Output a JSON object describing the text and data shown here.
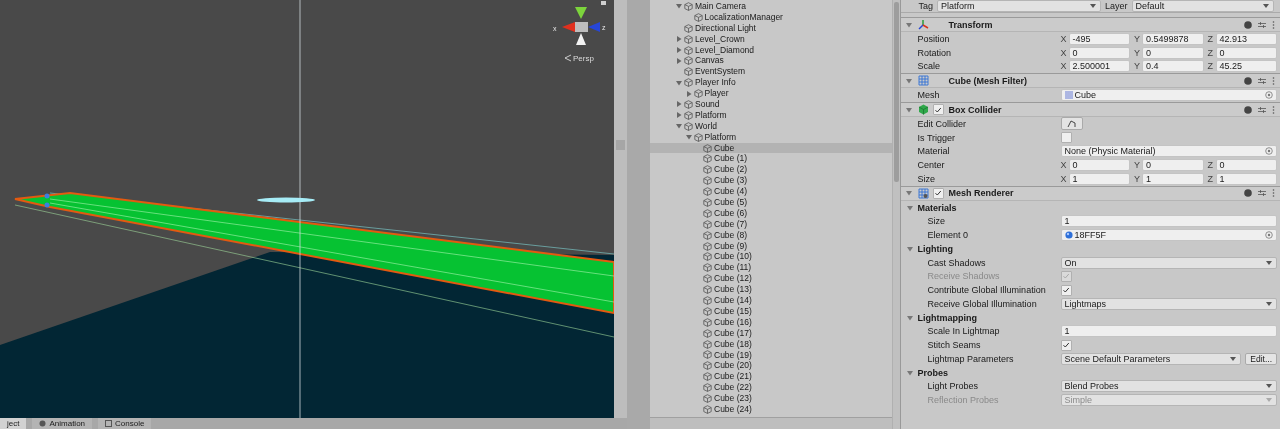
{
  "scene": {
    "gizmo": {
      "x_label": "x",
      "z_label": "z",
      "projection": "Persp"
    }
  },
  "bottom_tabs": [
    {
      "label": "ject",
      "selected": true
    },
    {
      "label": "Animation",
      "selected": false
    },
    {
      "label": "Console",
      "selected": false
    }
  ],
  "hierarchy": {
    "items": [
      {
        "label": "Main Camera",
        "expanded": true,
        "selected": false,
        "children": [
          {
            "label": "LocalizationManager",
            "selected": false
          }
        ]
      },
      {
        "label": "Directional Light",
        "selected": false
      },
      {
        "label": "Level_Crown",
        "expanded": false,
        "selected": false
      },
      {
        "label": "Level_Diamond",
        "expanded": false,
        "selected": false
      },
      {
        "label": "Canvas",
        "expanded": false,
        "selected": false
      },
      {
        "label": "EventSystem",
        "selected": false
      },
      {
        "label": "Player Info",
        "expanded": true,
        "selected": false,
        "children": [
          {
            "label": "Player",
            "expanded": false,
            "selected": false
          }
        ]
      },
      {
        "label": "Sound",
        "expanded": false,
        "selected": false
      },
      {
        "label": "Platform",
        "expanded": false,
        "selected": false
      },
      {
        "label": "World",
        "expanded": true,
        "selected": false,
        "children": [
          {
            "label": "Platform",
            "expanded": true,
            "selected": false,
            "children": [
              {
                "label": "Cube",
                "selected": true
              },
              {
                "label": "Cube (1)",
                "selected": false
              },
              {
                "label": "Cube (2)",
                "selected": false
              },
              {
                "label": "Cube (3)",
                "selected": false
              },
              {
                "label": "Cube (4)",
                "selected": false
              },
              {
                "label": "Cube (5)",
                "selected": false
              },
              {
                "label": "Cube (6)",
                "selected": false
              },
              {
                "label": "Cube (7)",
                "selected": false
              },
              {
                "label": "Cube (8)",
                "selected": false
              },
              {
                "label": "Cube (9)",
                "selected": false
              },
              {
                "label": "Cube (10)",
                "selected": false
              },
              {
                "label": "Cube (11)",
                "selected": false
              },
              {
                "label": "Cube (12)",
                "selected": false
              },
              {
                "label": "Cube (13)",
                "selected": false
              },
              {
                "label": "Cube (14)",
                "selected": false
              },
              {
                "label": "Cube (15)",
                "selected": false
              },
              {
                "label": "Cube (16)",
                "selected": false
              },
              {
                "label": "Cube (17)",
                "selected": false
              },
              {
                "label": "Cube (18)",
                "selected": false
              },
              {
                "label": "Cube (19)",
                "selected": false
              },
              {
                "label": "Cube (20)",
                "selected": false
              },
              {
                "label": "Cube (21)",
                "selected": false
              },
              {
                "label": "Cube (22)",
                "selected": false
              },
              {
                "label": "Cube (23)",
                "selected": false
              },
              {
                "label": "Cube (24)",
                "selected": false
              }
            ]
          }
        ]
      }
    ]
  },
  "inspector": {
    "tag": {
      "label": "Tag",
      "value": "Platform"
    },
    "layer": {
      "label": "Layer",
      "value": "Default"
    },
    "components": [
      {
        "title": "Transform",
        "kind": "transform",
        "expanded": true,
        "rows": [
          {
            "kind": "vector3",
            "label": "Position",
            "disabled": false,
            "values": [
              {
                "axis": "X",
                "value": "-495"
              },
              {
                "axis": "Y",
                "value": "0.5499878"
              },
              {
                "axis": "Z",
                "value": "42.913"
              }
            ]
          },
          {
            "kind": "vector3",
            "label": "Rotation",
            "disabled": false,
            "values": [
              {
                "axis": "X",
                "value": "0"
              },
              {
                "axis": "Y",
                "value": "0"
              },
              {
                "axis": "Z",
                "value": "0"
              }
            ]
          },
          {
            "kind": "vector3",
            "label": "Scale",
            "disabled": false,
            "values": [
              {
                "axis": "X",
                "value": "2.500001"
              },
              {
                "axis": "Y",
                "value": "0.4"
              },
              {
                "axis": "Z",
                "value": "45.25"
              }
            ]
          }
        ]
      },
      {
        "title": "Cube (Mesh Filter)",
        "kind": "meshfilter",
        "expanded": true,
        "rows": [
          {
            "kind": "meshref",
            "label": "Mesh",
            "value": "Cube",
            "disabled": false
          }
        ]
      },
      {
        "title": "Box Collider",
        "kind": "collider",
        "enabled": true,
        "expanded": true,
        "rows": [
          {
            "kind": "button",
            "label": "Edit Collider",
            "disabled": false
          },
          {
            "kind": "checkbox",
            "label": "Is Trigger",
            "checked": false,
            "disabled": false
          },
          {
            "kind": "object",
            "label": "Material",
            "value": "None (Physic Material)",
            "disabled": false
          },
          {
            "kind": "vector3",
            "label": "Center",
            "disabled": false,
            "values": [
              {
                "axis": "X",
                "value": "0"
              },
              {
                "axis": "Y",
                "value": "0"
              },
              {
                "axis": "Z",
                "value": "0"
              }
            ]
          },
          {
            "kind": "vector3",
            "label": "Size",
            "disabled": false,
            "values": [
              {
                "axis": "X",
                "value": "1"
              },
              {
                "axis": "Y",
                "value": "1"
              },
              {
                "axis": "Z",
                "value": "1"
              }
            ]
          }
        ]
      },
      {
        "title": "Mesh Renderer",
        "kind": "renderer",
        "enabled": true,
        "expanded": true,
        "rows": [
          {
            "kind": "section",
            "label": "Materials",
            "expanded": true,
            "disabled": false,
            "rows": [
              {
                "kind": "text",
                "label": "Size",
                "value": "1",
                "disabled": false
              },
              {
                "kind": "materialref",
                "label": "Element 0",
                "value": "18FF5F",
                "disabled": false
              }
            ]
          },
          {
            "kind": "section",
            "label": "Lighting",
            "expanded": true,
            "disabled": false,
            "rows": [
              {
                "kind": "dropdown",
                "label": "Cast Shadows",
                "value": "On",
                "disabled": false
              },
              {
                "kind": "checkbox",
                "label": "Receive Shadows",
                "checked": true,
                "disabled": true
              },
              {
                "kind": "checkbox",
                "label": "Contribute Global Illumination",
                "checked": true,
                "disabled": false
              },
              {
                "kind": "dropdown",
                "label": "Receive Global Illumination",
                "value": "Lightmaps",
                "disabled": false
              }
            ]
          },
          {
            "kind": "section",
            "label": "Lightmapping",
            "expanded": true,
            "disabled": false,
            "rows": [
              {
                "kind": "text",
                "label": "Scale In Lightmap",
                "value": "1",
                "disabled": false
              },
              {
                "kind": "checkbox",
                "label": "Stitch Seams",
                "checked": true,
                "disabled": false
              },
              {
                "kind": "dropdown",
                "label": "Lightmap Parameters",
                "value": "Scene Default Parameters",
                "button": "Edit...",
                "disabled": false
              }
            ]
          },
          {
            "kind": "section",
            "label": "Probes",
            "expanded": true,
            "disabled": false,
            "rows": [
              {
                "kind": "dropdown",
                "label": "Light Probes",
                "value": "Blend Probes",
                "disabled": false
              },
              {
                "kind": "dropdown",
                "label": "Reflection Probes",
                "value": "Simple",
                "disabled": true
              }
            ]
          }
        ]
      }
    ]
  }
}
